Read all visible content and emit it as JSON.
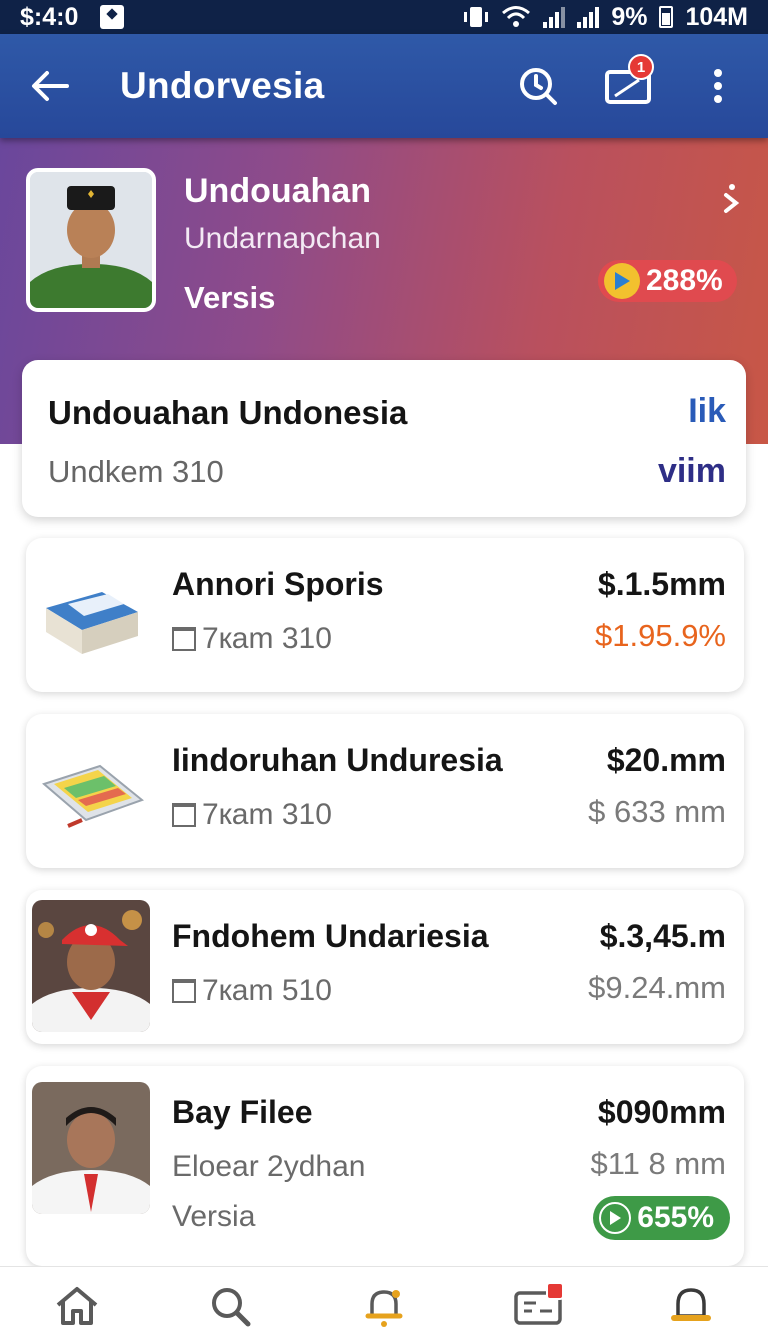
{
  "status_bar": {
    "time": "$:4:0",
    "battery_label": "9%",
    "right_text": "104M"
  },
  "app_bar": {
    "title": "Undorvesia",
    "notification_count": "1"
  },
  "hero": {
    "name": "Undouahan",
    "subtitle": "Undarnapchan",
    "version": "Versis",
    "change": "288%"
  },
  "summary": {
    "title": "Undouahan Undonesia",
    "subtitle": "Undkem 310",
    "brand_top": "Iik",
    "brand_bottom": "viim"
  },
  "items": [
    {
      "title": "Annori Sporis",
      "meta": "7кam 310",
      "price": "$.1.5mm",
      "change": "$1.95.9%"
    },
    {
      "title": "Iindoruhan Unduresia",
      "meta": "7кam 310",
      "price": "$20.mm",
      "change": "$ 633 mm"
    },
    {
      "title": "Fndohem Undariesia",
      "meta": "7кam 510",
      "price": "$.3,45.m",
      "change": "$9.24.mm"
    },
    {
      "title": "Bay Filee",
      "meta": "Eloear 2ydhan",
      "extra": "Versia",
      "price": "$090mm",
      "change": "$11 8 mm",
      "badge": "655%"
    }
  ],
  "colors": {
    "accent": "#2f59a8",
    "up": "#e8641d",
    "positive": "#3e9a47",
    "alert": "#e53935"
  }
}
